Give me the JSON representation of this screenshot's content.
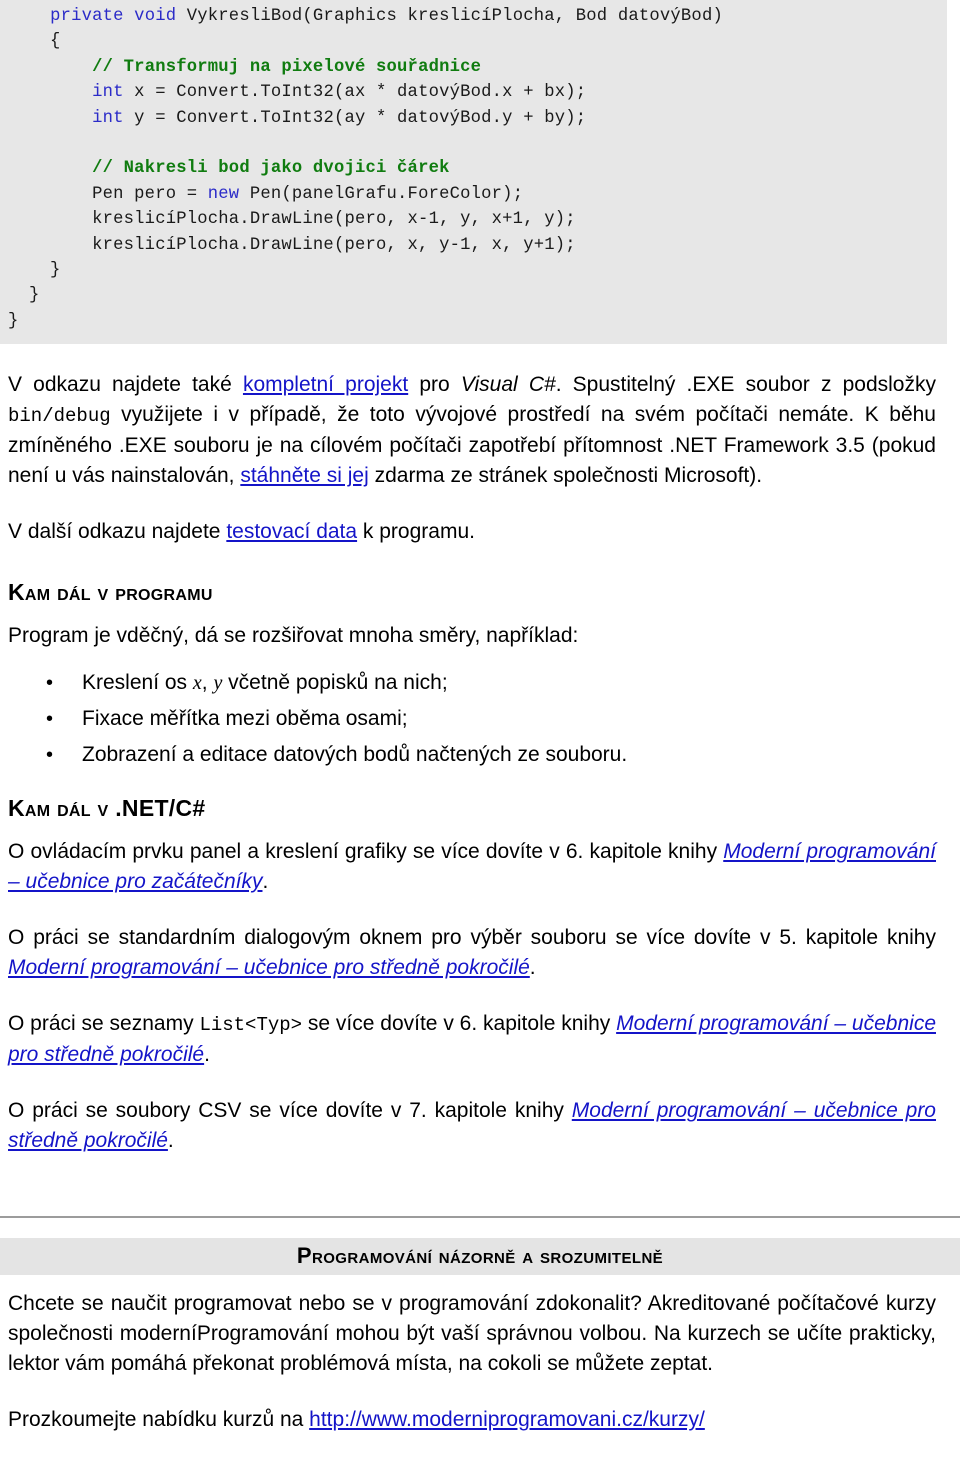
{
  "code_block": {
    "language": "csharp",
    "lines": [
      [
        {
          "t": "    ",
          "c": "plain"
        },
        {
          "t": "private void",
          "c": "kw"
        },
        {
          "t": " VykresliBod(Graphics kreslicíPlocha, Bod datovýBod)",
          "c": "plain"
        }
      ],
      [
        {
          "t": "    {",
          "c": "plain"
        }
      ],
      [
        {
          "t": "        ",
          "c": "plain"
        },
        {
          "t": "// Transformuj na pixelové souřadnice",
          "c": "cmt"
        }
      ],
      [
        {
          "t": "        ",
          "c": "plain"
        },
        {
          "t": "int",
          "c": "kw"
        },
        {
          "t": " x = Convert.ToInt32(ax * datovýBod.x + bx);",
          "c": "plain"
        }
      ],
      [
        {
          "t": "        ",
          "c": "plain"
        },
        {
          "t": "int",
          "c": "kw"
        },
        {
          "t": " y = Convert.ToInt32(ay * datovýBod.y + by);",
          "c": "plain"
        }
      ],
      [],
      [
        {
          "t": "        ",
          "c": "plain"
        },
        {
          "t": "// Nakresli bod jako dvojici čárek",
          "c": "cmt"
        }
      ],
      [
        {
          "t": "        Pen pero = ",
          "c": "plain"
        },
        {
          "t": "new",
          "c": "kw"
        },
        {
          "t": " Pen(panelGrafu.ForeColor);",
          "c": "plain"
        }
      ],
      [
        {
          "t": "        kreslicíPlocha.DrawLine(pero, x-1, y, x+1, y);",
          "c": "plain"
        }
      ],
      [
        {
          "t": "        kreslicíPlocha.DrawLine(pero, x, y-1, x, y+1);",
          "c": "plain"
        }
      ],
      [
        {
          "t": "    }",
          "c": "plain"
        }
      ],
      [
        {
          "t": "  }",
          "c": "plain"
        }
      ],
      [
        {
          "t": "}",
          "c": "plain"
        }
      ]
    ]
  },
  "paragraph_project": {
    "seg1": "V odkazu najdete také ",
    "link_project": "kompletní projekt",
    "seg2": " pro ",
    "italic_visual": "Visual C#",
    "seg3": ". Spustitelný .EXE soubor z podsložky ",
    "mono_bindebug": "bin/debug",
    "seg4": " využijete i v případě, že toto vývojové prostředí na svém počítači nemáte. K běhu zmíněného .EXE souboru je na cílovém počítači zapotřebí přítomnost .NET Framework 3.5 (pokud není u vás nainstalován, ",
    "link_download": "stáhněte si jej",
    "seg5": " zdarma ze stránek společnosti Microsoft)."
  },
  "paragraph_testdata": {
    "seg1": "V další odkazu najdete ",
    "link_testdata": "testovací data",
    "seg2": " k programu."
  },
  "heading_kam_dal_v_programu": "Kam dál v programu",
  "paragraph_program_intro": "Program je vděčný, dá se rozšiřovat mnoha směry, například:",
  "bullets": [
    {
      "seg1": "Kreslení os ",
      "var_x": "x",
      "seg2": ", ",
      "var_y": "y",
      "seg3": " včetně popisků na nich;"
    },
    {
      "seg1": "Fixace měřítka mezi oběma osami;"
    },
    {
      "seg1": "Zobrazení a editace datových bodů načtených ze souboru."
    }
  ],
  "heading_kam_dal_v_net": "Kam dál v .NET/C#",
  "paragraph_panel": {
    "seg1": "O ovládacím prvku panel a kreslení grafiky se více dovíte v 6. kapitole knihy ",
    "link_book": "Moderní programování – učebnice pro začátečníky",
    "seg2": "."
  },
  "paragraph_dialog": {
    "seg1": "O práci se standardním dialogovým oknem pro výběr souboru se více dovíte v 5. kapitole knihy ",
    "link_book": "Moderní programování – učebnice pro středně pokročilé",
    "seg2": "."
  },
  "paragraph_list": {
    "seg1": "O práci se seznamy ",
    "mono_list": "List<Typ>",
    "seg2": " se více dovíte v 6. kapitole knihy ",
    "link_book": "Moderní programování – učebnice pro středně pokročilé",
    "seg3": "."
  },
  "paragraph_csv": {
    "seg1": "O práci se soubory CSV se více dovíte v 7. kapitole knihy ",
    "link_book": "Moderní programování – učebnice pro středně pokročilé",
    "seg2": "."
  },
  "promo": {
    "title": "Programování názorně a srozumitelně",
    "body": "Chcete se naučit programovat nebo se v programování zdokonalit? Akreditované počítačové kurzy společnosti moderníProgramování mohou být vaší správnou volbou. Na kurzech se učíte prakticky, lektor vám pomáhá překonat problémová místa, na cokoli se můžete zeptat.",
    "cta_prefix": "Prozkoumejte nabídku kurzů na ",
    "cta_link": "http://www.moderniprogramovani.cz/kurzy/"
  },
  "colors": {
    "code_background": "#e7e7e7",
    "keyword": "#2b2bc8",
    "comment": "#107c10",
    "link": "#1414c8",
    "promo_band": "#e4e4e4",
    "divider": "#9c9c9c",
    "text": "#000000"
  }
}
